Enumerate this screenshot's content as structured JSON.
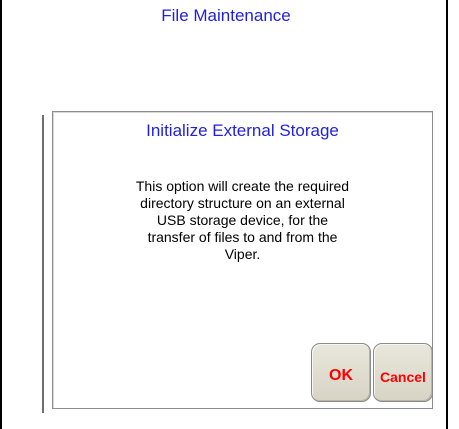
{
  "header": {
    "title": "File Maintenance"
  },
  "dialog": {
    "title": "Initialize External Storage",
    "message_lines": [
      "This option will create the required",
      "directory structure on an external",
      "USB storage device, for the",
      "transfer of files to and from the",
      "Viper."
    ],
    "ok_label": "OK",
    "cancel_label": "Cancel"
  },
  "colors": {
    "title_text": "#1f1fe0",
    "button_text": "#ff0000",
    "button_face": "#e2dfd3"
  }
}
